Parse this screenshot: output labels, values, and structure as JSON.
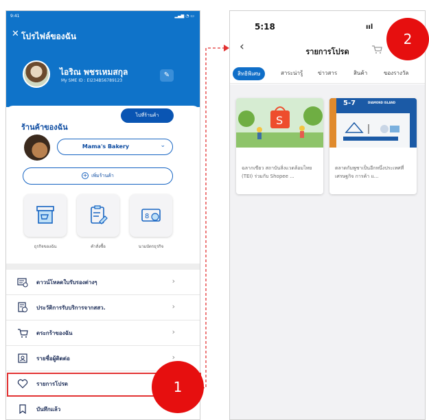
{
  "left_screen": {
    "status_time": "9:41",
    "page_title": "โปรไฟล์ของฉัน",
    "profile": {
      "name": "ไอริณ พชรเหมสกุล",
      "sme_id": "My SME ID : EI234B56789123"
    },
    "shop": {
      "title": "ร้านค้าของฉัน",
      "go_to_shop": "ไปที่ร้านค้า",
      "selected_shop": "Mama's Bakery",
      "add_shop": "เพิ่มร้านค้า"
    },
    "tiles": [
      {
        "label": "ธุรกิจของฉัน",
        "icon": "shop-icon"
      },
      {
        "label": "คำสั่งซื้อ",
        "icon": "clipboard-icon"
      },
      {
        "label": "นามบัตรธุรกิจ",
        "icon": "business-card-icon"
      }
    ],
    "menu": [
      {
        "label": "ดาวน์โหลดใบรับรองต่างๆ",
        "icon": "certificate-download-icon"
      },
      {
        "label": "ประวัติการรับบริการจากสสว.",
        "icon": "service-history-icon"
      },
      {
        "label": "ตระกร้าของฉัน",
        "icon": "cart-icon"
      },
      {
        "label": "รายชื่อผู้ติดต่อ",
        "icon": "contact-list-icon"
      },
      {
        "label": "รายการโปรด",
        "icon": "heart-icon"
      },
      {
        "label": "บันทึกแล้ว",
        "icon": "bookmark-icon"
      }
    ]
  },
  "right_screen": {
    "status_time": "5:18",
    "status_signal": "ııl",
    "title": "รายการโปรด",
    "tabs": [
      "สิทธิพิเศษ",
      "สาระน่ารู้",
      "ข่าวสาร",
      "สินค้า",
      "ของรางวัล"
    ],
    "active_tab": "สิทธิพิเศษ",
    "cards": [
      {
        "text": "ฉลากเขียว สถาบันสิ่งแวดล้อมไทย (TEI) ร่วมกับ Shopee ..."
      },
      {
        "text": "ตลาดกัมพูชาเป็นอีกหนึ่งประเทศที่เศรษฐกิจ การค้า แ..."
      }
    ],
    "card2_banner": {
      "number": "5-7",
      "tag": "DIAMOND ISLAND"
    }
  },
  "callouts": [
    "1",
    "2"
  ],
  "colors": {
    "brand_blue": "#0f73c9",
    "accent_red": "#e60f0f",
    "navy_text": "#1c2d58"
  }
}
